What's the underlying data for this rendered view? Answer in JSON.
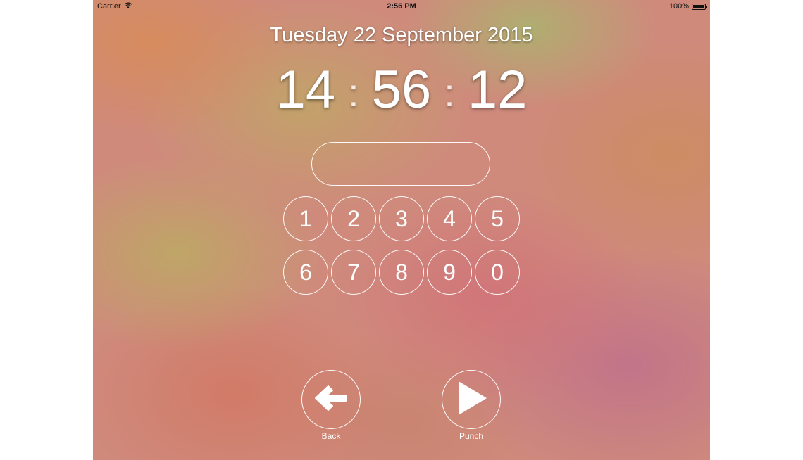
{
  "status_bar": {
    "carrier": "Carrier",
    "time": "2:56 PM",
    "battery": "100%",
    "wifi_icon": "wifi-icon",
    "battery_icon": "battery-icon"
  },
  "date_label": "Tuesday 22 September 2015",
  "clock": {
    "hours": "14",
    "minutes": "56",
    "seconds": "12",
    "separator": ":"
  },
  "pin_field": {
    "value": "",
    "placeholder": ""
  },
  "keypad": {
    "keys": [
      "1",
      "2",
      "3",
      "4",
      "5",
      "6",
      "7",
      "8",
      "9",
      "0"
    ]
  },
  "actions": {
    "back_label": "Back",
    "back_icon": "arrow-left-icon",
    "punch_label": "Punch",
    "punch_icon": "play-icon"
  },
  "colors": {
    "foreground": "#ffffff",
    "status_text": "#111111"
  }
}
